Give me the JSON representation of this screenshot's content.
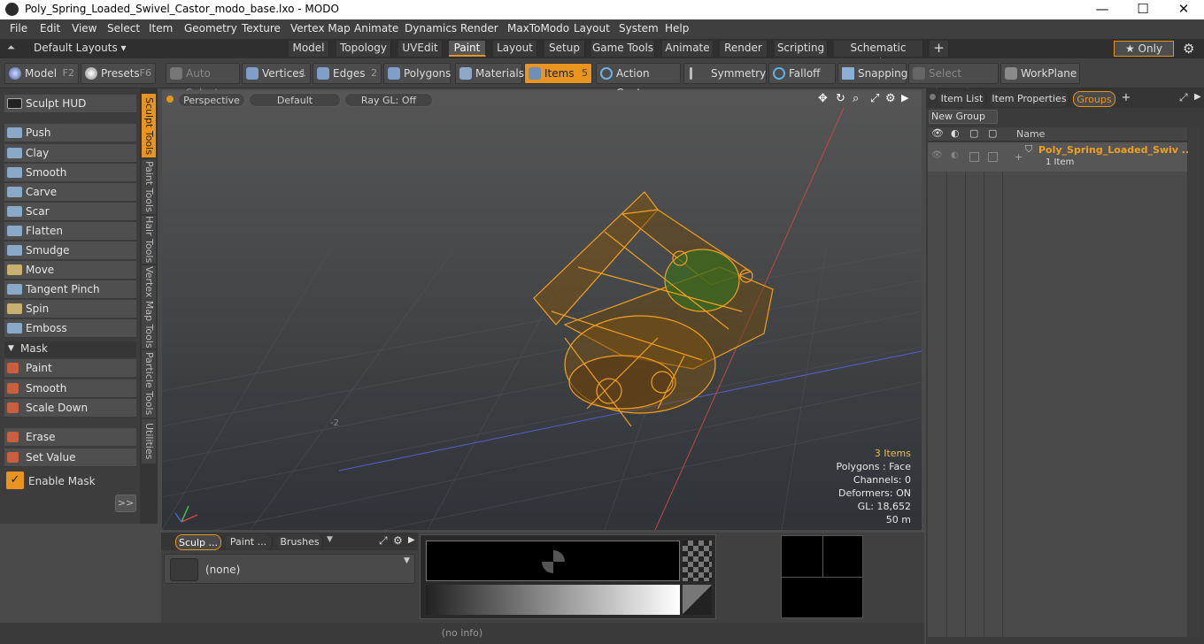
{
  "window": {
    "title": "Poly_Spring_Loaded_Swivel_Castor_modo_base.lxo - MODO",
    "minimize": "—",
    "maximize": "☐",
    "close": "✕"
  },
  "menu": [
    "File",
    "Edit",
    "View",
    "Select",
    "Item",
    "Geometry",
    "Texture",
    "Vertex Map",
    "Animate",
    "Dynamics",
    "Render",
    "MaxToModo",
    "Layout",
    "System",
    "Help"
  ],
  "layouts": {
    "label": "Default Layouts ▾"
  },
  "tabs": [
    "Model",
    "Topology",
    "UVEdit",
    "Paint",
    "Layout",
    "Setup",
    "Game Tools",
    "Animate",
    "Render",
    "Scripting",
    "Schematic Fusion",
    "+"
  ],
  "tabs_active": "Paint",
  "only": "★ Only",
  "toolbar": {
    "model": "Model",
    "model_key": "F2",
    "presets": "Presets",
    "presets_key": "F6",
    "auto_select": "Auto Select",
    "vertices": "Vertices",
    "vertices_key": "1",
    "edges": "Edges",
    "edges_key": "2",
    "polygons": "Polygons",
    "materials": "Materials",
    "items": "Items",
    "items_key": "5",
    "action_center": "Action Center",
    "symmetry": "Symmetry",
    "falloff": "Falloff",
    "snapping": "Snapping",
    "select_through": "Select Through",
    "workplane": "WorkPlane"
  },
  "sculpt": {
    "hud": "Sculpt HUD",
    "tools": [
      "Push",
      "Clay",
      "Smooth",
      "Carve",
      "Scar",
      "Flatten",
      "Smudge",
      "Move",
      "Tangent Pinch",
      "Spin",
      "Emboss"
    ],
    "mask_header": "Mask",
    "mask_tools": [
      "Paint",
      "Smooth",
      "Scale Down"
    ],
    "erase": "Erase",
    "set_value": "Set Value",
    "enable_mask": "Enable Mask",
    "more": ">>"
  },
  "vtabs": [
    "Sculpt Tools",
    "Paint Tools",
    "Hair Tools",
    "Vertex Map Tools",
    "Particle Tools",
    "Utilities"
  ],
  "viewport": {
    "view": "Perspective",
    "shading": "Default",
    "raygl": "Ray GL: Off",
    "coord": "-2",
    "stats": {
      "items": "3 Items",
      "polygons": "Polygons : Face",
      "channels": "Channels: 0",
      "deformers": "Deformers: ON",
      "gl": "GL: 18,652",
      "scale": "50 m"
    }
  },
  "bottom": {
    "tabs": [
      "Sculp ...",
      "Paint ...",
      "Brushes"
    ],
    "preset": "(none)",
    "status": "(no info)"
  },
  "right": {
    "tabs": [
      "Item List",
      "Item Properties",
      "Groups",
      "+"
    ],
    "new_group": "New Group",
    "col_name": "Name",
    "group_name": "Poly_Spring_Loaded_Swiv ...",
    "group_count": "1 Item"
  },
  "colors": {
    "accent": "#e8941e",
    "wire": "#f0a020"
  }
}
